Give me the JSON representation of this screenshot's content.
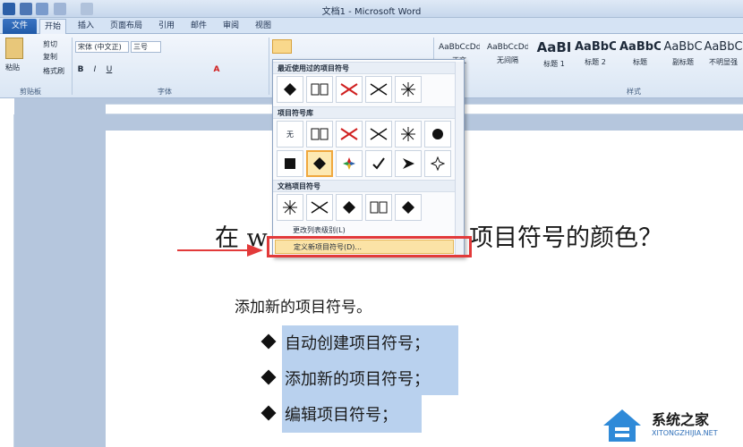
{
  "window": {
    "title": "文档1 - Microsoft Word"
  },
  "tabs": [
    {
      "label": "文件"
    },
    {
      "label": "开始"
    },
    {
      "label": "插入"
    },
    {
      "label": "页面布局"
    },
    {
      "label": "引用"
    },
    {
      "label": "邮件"
    },
    {
      "label": "审阅"
    },
    {
      "label": "视图"
    }
  ],
  "ribbon": {
    "clipboard": {
      "paste": "粘贴",
      "cut": "剪切",
      "copy": "复制",
      "format_painter": "格式刷",
      "label": "剪贴板"
    },
    "font": {
      "name": "宋体 (中文正)",
      "size": "三号",
      "label": "字体"
    },
    "styles": {
      "label": "样式",
      "items": [
        {
          "sample": "AaBbCcDd",
          "name": "正文"
        },
        {
          "sample": "AaBbCcDd",
          "name": "无间隔"
        },
        {
          "sample": "AaBI",
          "name": "标题 1"
        },
        {
          "sample": "AaBbC",
          "name": "标题 2"
        },
        {
          "sample": "AaBbC",
          "name": "标题"
        },
        {
          "sample": "AaBbC",
          "name": "副标题"
        },
        {
          "sample": "AaBbC",
          "name": "不明显强"
        }
      ]
    }
  },
  "bullet_menu": {
    "recent_header": "最近使用过的项目符号",
    "library_header": "项目符号库",
    "document_header": "文档项目符号",
    "none_label": "无",
    "change_level": "更改列表级别(L)",
    "define_new": "定义新项目符号(D)..."
  },
  "document": {
    "title_prefix": "在 w",
    "title_suffix": "项目符号的颜色？",
    "intro": "添加新的项目符号。",
    "bullets": [
      "自动创建项目符号；",
      "添加新的项目符号；",
      "编辑项目符号；"
    ]
  },
  "watermark": {
    "name": "系统之家",
    "url": "XITONGZHIJIA.NET"
  },
  "colors": {
    "accent": "#2b5fa8",
    "highlight": "#e23a3a",
    "selection": "#b9d1ee"
  }
}
